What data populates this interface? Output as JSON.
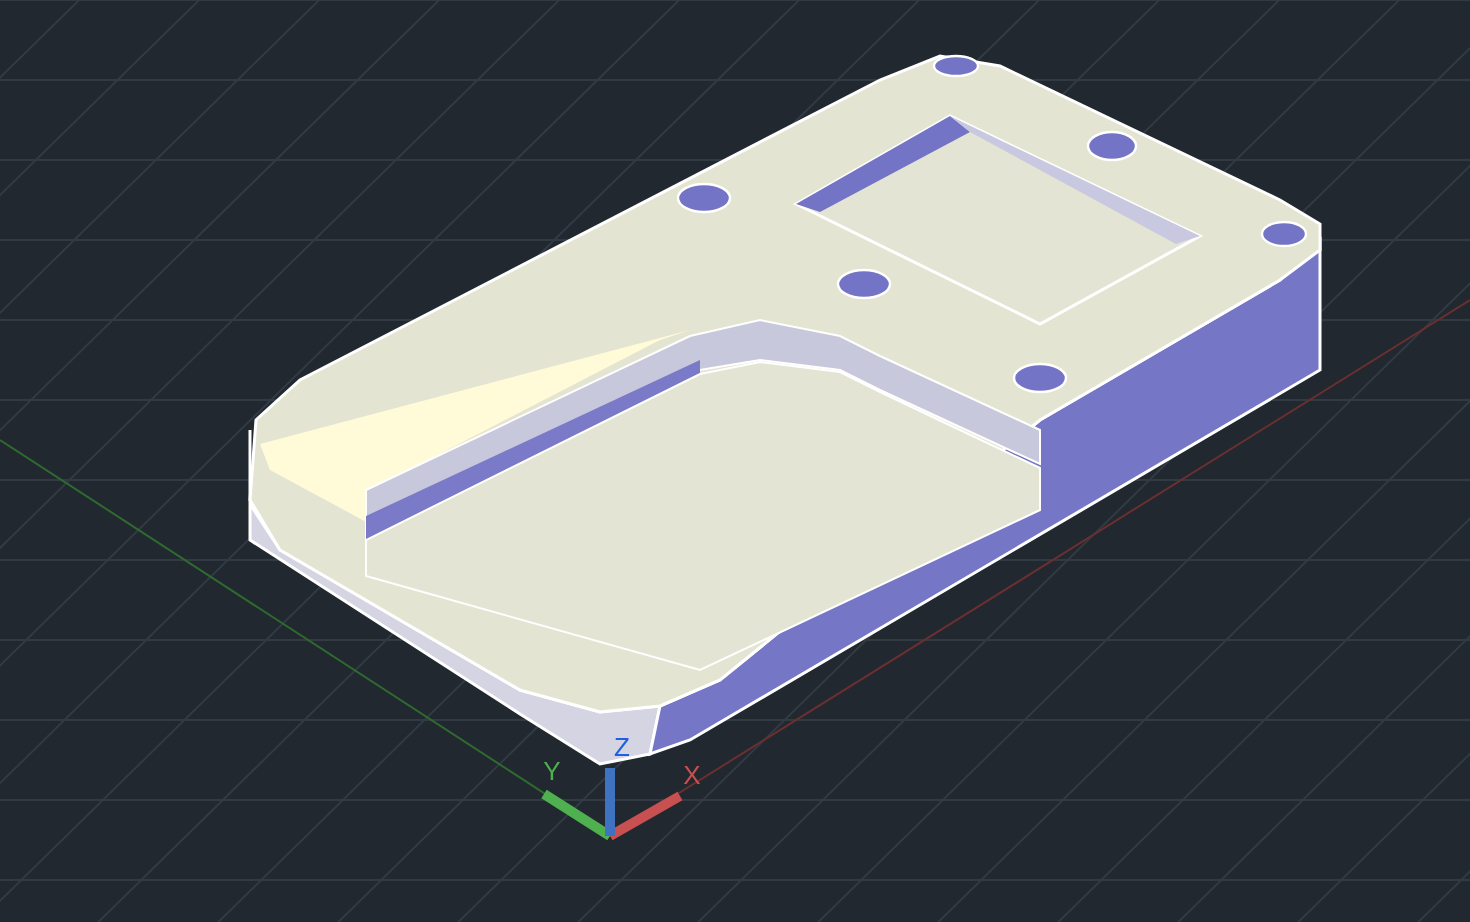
{
  "viewport": {
    "ucs_axes": [
      {
        "label": "X",
        "color": "#c85050"
      },
      {
        "label": "Y",
        "color": "#4fb04f"
      },
      {
        "label": "Z",
        "color": "#3f72c0"
      }
    ]
  }
}
